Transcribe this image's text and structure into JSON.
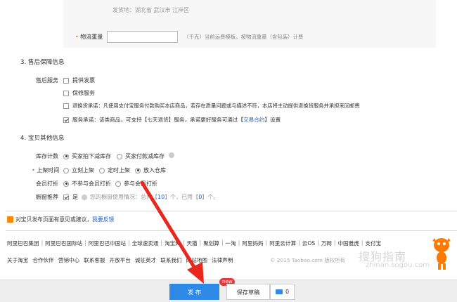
{
  "top": {
    "origin_text": "发货地：湖北省 武汉市 江岸区",
    "weight_label": "物流重量",
    "weight_value": "",
    "weight_hint": "（千克）当前运费模板，按物流重量（含包装）计费"
  },
  "after_sale": {
    "title": "3. 售后保障信息",
    "service_label": "售后服务",
    "options": [
      {
        "label": "提供发票",
        "checked": false
      },
      {
        "label": "保修服务",
        "checked": false
      },
      {
        "label": "退换货承诺：凡使用支付宝服务付款购买本店商品，若存在质量问题或与描述不符，本店将主动提供退换货服务并承担来回邮费",
        "checked": false
      }
    ],
    "commit_prefix": "服务承诺：该类商品，可支持【七天退货】服务，承诺更好服务可通过【",
    "commit_link": "交易合约",
    "commit_suffix": "】设置"
  },
  "other": {
    "title": "4. 宝贝其他信息",
    "inventory": {
      "label": "库存计数",
      "options": [
        "买家拍下减库存",
        "买家付款减库存"
      ],
      "selected": 0
    },
    "listing": {
      "label": "上架时间",
      "options": [
        "立刻上架",
        "定时上架",
        "放入仓库"
      ],
      "selected": 2
    },
    "member": {
      "label": "会员打折",
      "options": [
        "不参与会员打折",
        "参与会员打折"
      ],
      "selected": 0
    },
    "window": {
      "label": "橱窗推荐",
      "yes_label": "是",
      "usage_prefix": "您的橱窗使用情况：总共【",
      "usage_total": "10",
      "usage_mid": "】个，已用【",
      "usage_used": "0",
      "usage_suffix": "】个。"
    }
  },
  "feedback": {
    "text": "对宝贝发布页面有意见或建议，",
    "link": "我要反馈"
  },
  "footer_links_1": [
    "阿里巴巴集团",
    "阿里巴巴国际站",
    "阿里巴巴中国站",
    "全球速卖通",
    "淘宝网",
    "天猫",
    "聚划算",
    "一淘",
    "阿里妈妈",
    "阿里云计算",
    "云OS",
    "万网",
    "中国雅虎",
    "支付宝"
  ],
  "footer_links_2": [
    "关于淘宝",
    "合作伙伴",
    "营销中心",
    "联系客服",
    "开放平台",
    "诚征英才",
    "联系我们",
    "网站地图",
    "法律声明"
  ],
  "copyright": "© 2015 Taobao.com 版权所有",
  "watermark": "搜狗指南",
  "watermark_url": "zhinan.sogou.com",
  "bottom": {
    "publish_label": "发 布",
    "new_badge": "new",
    "draft_label": "保存草稿",
    "message_count": "0"
  },
  "colors": {
    "accent_blue": "#2e8ae6",
    "link_blue": "#1f5fbf",
    "required_orange": "#ff6a00",
    "arrow_red": "#e8281e",
    "badge_red": "#e4393c"
  }
}
